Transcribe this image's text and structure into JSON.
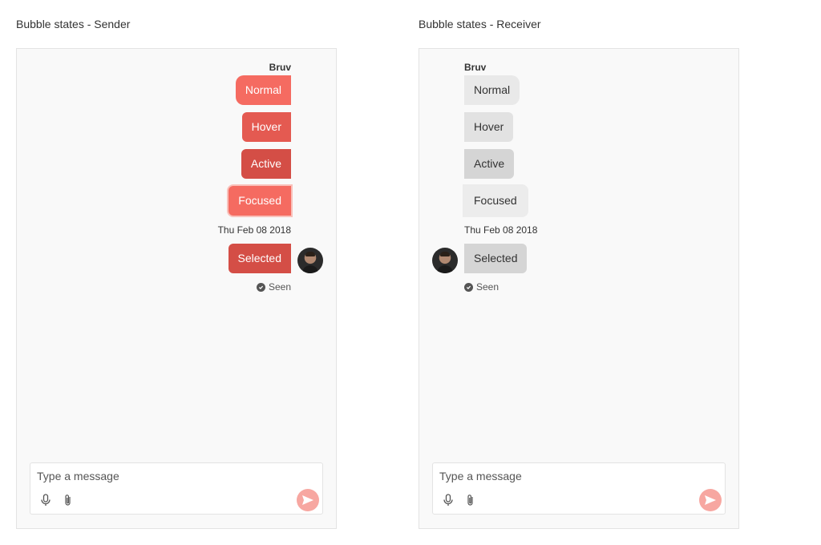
{
  "sender": {
    "title": "Bubble states - Sender",
    "author": "Bruv",
    "bubbles": {
      "normal": "Normal",
      "hover": "Hover",
      "active": "Active",
      "focused": "Focused",
      "selected": "Selected"
    },
    "timestamp": "Thu Feb 08 2018",
    "status": "Seen",
    "composer": {
      "placeholder": "Type a message"
    }
  },
  "receiver": {
    "title": "Bubble states - Receiver",
    "author": "Bruv",
    "bubbles": {
      "normal": "Normal",
      "hover": "Hover",
      "active": "Active",
      "focused": "Focused",
      "selected": "Selected"
    },
    "timestamp": "Thu Feb 08 2018",
    "status": "Seen",
    "composer": {
      "placeholder": "Type a message"
    }
  },
  "colors": {
    "sender_normal": "#f56b61",
    "sender_hover": "#e45a51",
    "sender_active": "#d44e46",
    "receiver_normal": "#e9e9e9",
    "receiver_active": "#d5d5d5",
    "send_button": "#f7a7a1"
  },
  "icons": [
    "microphone-icon",
    "paperclip-icon",
    "send-icon",
    "check-circle-icon"
  ]
}
